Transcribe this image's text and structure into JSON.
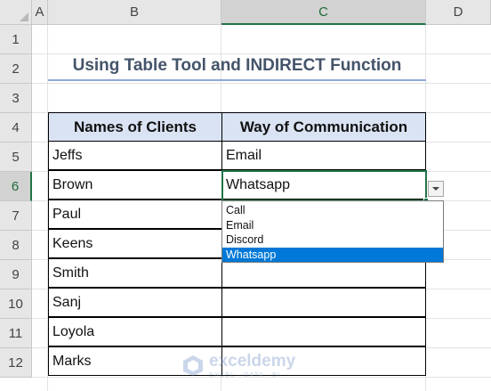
{
  "columns": [
    "A",
    "B",
    "C",
    "D"
  ],
  "rows": [
    "1",
    "2",
    "3",
    "4",
    "5",
    "6",
    "7",
    "8",
    "9",
    "10",
    "11",
    "12"
  ],
  "title": "Using Table Tool and INDIRECT Function",
  "table": {
    "headers": [
      "Names of Clients",
      "Way of Communication"
    ],
    "rows": [
      [
        "Jeffs",
        "Email"
      ],
      [
        "Brown",
        "Whatsapp"
      ],
      [
        "Paul",
        ""
      ],
      [
        "Keens",
        ""
      ],
      [
        "Smith",
        ""
      ],
      [
        "Sanj",
        ""
      ],
      [
        "Loyola",
        ""
      ],
      [
        "Marks",
        ""
      ]
    ]
  },
  "selected_cell": "C6",
  "dropdown": {
    "options": [
      "Call",
      "Email",
      "Discord",
      "Whatsapp"
    ],
    "highlighted": "Whatsapp",
    "highlight_color": "#0078d7"
  },
  "watermark": {
    "brand": "exceldemy",
    "tagline": "EXCEL · DATA · BI"
  },
  "colors": {
    "accent": "#217346",
    "header_fill": "#dae3f3",
    "title_color": "#44546a"
  }
}
